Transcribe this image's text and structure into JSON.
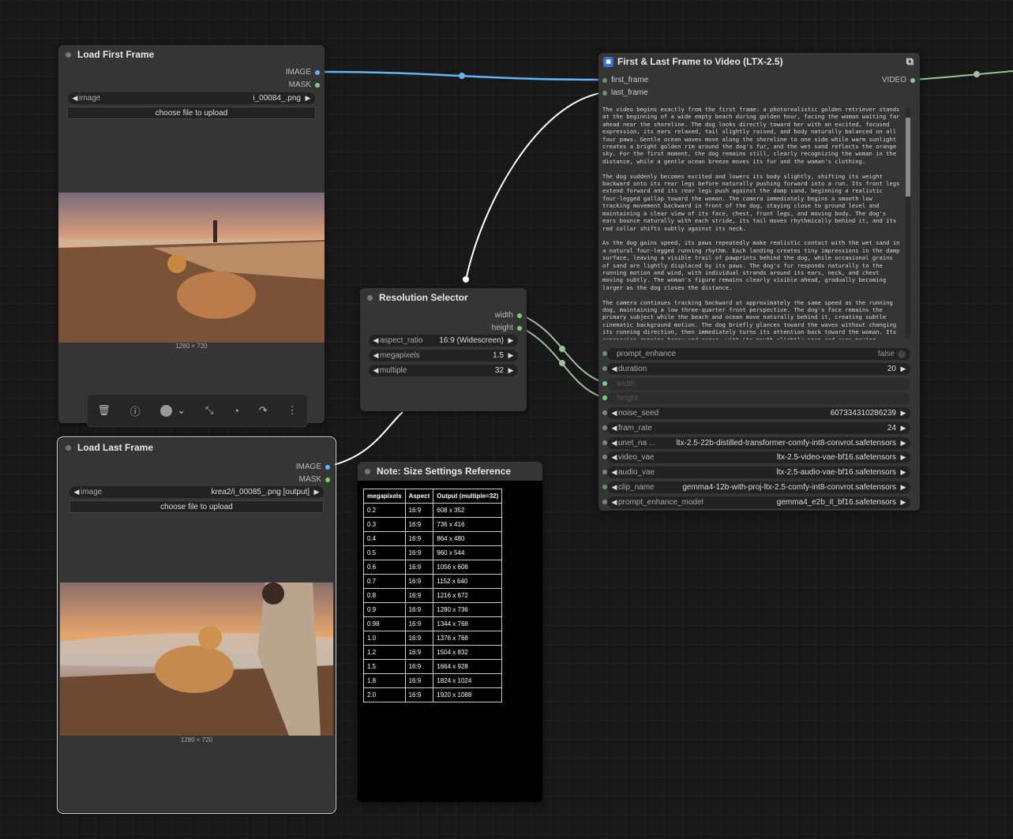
{
  "nodes": {
    "load_first": {
      "title": "Load First Frame",
      "out_image": "IMAGE",
      "out_mask": "MASK",
      "image_label": "image",
      "image_value": "i_00084_.png",
      "upload_label": "choose file to upload",
      "dims": "1280 × 720"
    },
    "load_last": {
      "title": "Load Last Frame",
      "out_image": "IMAGE",
      "out_mask": "MASK",
      "image_label": "image",
      "image_value": "krea2/i_00085_.png [output]",
      "upload_label": "choose file to upload",
      "dims": "1280 × 720"
    },
    "resolution": {
      "title": "Resolution Selector",
      "out_width": "width",
      "out_height": "height",
      "widgets": [
        {
          "label": "aspect_ratio",
          "value": "16:9 (Widescreen)"
        },
        {
          "label": "megapixels",
          "value": "1.5"
        },
        {
          "label": "multiple",
          "value": "32"
        }
      ]
    },
    "note": {
      "title": "Note: Size Settings Reference",
      "headers": [
        "megapixels",
        "Aspect",
        "Output (multiple=32)"
      ],
      "rows": [
        [
          "0.2",
          "16:9",
          "608 x 352"
        ],
        [
          "0.3",
          "16:9",
          "736 x 416"
        ],
        [
          "0.4",
          "16:9",
          "864 x 480"
        ],
        [
          "0.5",
          "16:9",
          "960 x 544"
        ],
        [
          "0.6",
          "16:9",
          "1056 x 608"
        ],
        [
          "0.7",
          "16:9",
          "1152 x 640"
        ],
        [
          "0.8",
          "16:9",
          "1216 x 672"
        ],
        [
          "0.9",
          "16:9",
          "1280 x 736"
        ],
        [
          "0.98",
          "16:9",
          "1344 x 768"
        ],
        [
          "1.0",
          "16:9",
          "1376 x 768"
        ],
        [
          "1.2",
          "16:9",
          "1504 x 832"
        ],
        [
          "1.5",
          "16:9",
          "1664 x 928"
        ],
        [
          "1.8",
          "16:9",
          "1824 x 1024"
        ],
        [
          "2.0",
          "16:9",
          "1920 x 1088"
        ]
      ]
    },
    "ltx": {
      "title": "First & Last Frame to Video (LTX-2.5)",
      "in_first": "first_frame",
      "in_last": "last_frame",
      "out_video": "VIDEO",
      "prompt": "The video begins exactly from the first frame: a photorealistic golden retriever stands at the beginning of a wide empty beach during golden hour, facing the woman waiting far ahead near the shoreline. The dog looks directly toward her with an excited, focused expression, its ears relaxed, tail slightly raised, and body naturally balanced on all four paws. Gentle ocean waves move along the shoreline to one side while warm sunlight creates a bright golden rim around the dog's fur, and the wet sand reflects the orange sky. For the first moment, the dog remains still, clearly recognizing the woman in the distance, while a gentle ocean breeze moves its fur and the woman's clothing.\n\nThe dog suddenly becomes excited and lowers its body slightly, shifting its weight backward onto its rear legs before naturally pushing forward into a run. Its front legs extend forward and its rear legs push against the damp sand, beginning a realistic four-legged gallop toward the woman. The camera immediately begins a smooth low tracking movement backward in front of the dog, staying close to ground level and maintaining a clear view of its face, chest, front legs, and moving body. The dog's ears bounce naturally with each stride, its tail moves rhythmically behind it, and its red collar shifts subtly against its neck.\n\nAs the dog gains speed, its paws repeatedly make realistic contact with the wet sand in a natural four-legged running rhythm. Each landing creates tiny impressions in the damp surface, leaving a visible trail of pawprints behind the dog, while occasional grains of sand are lightly displaced by its paws. The dog's fur responds naturally to the running motion and wind, with individual strands around its ears, neck, and chest moving subtly. The woman's figure remains clearly visible ahead, gradually becoming larger as the dog closes the distance.\n\nThe camera continues tracking backward at approximately the same speed as the running dog, maintaining a low three-quarter front perspective. The dog's face remains the primary subject while the beach and ocean move naturally behind it, creating subtle cinematic background motion. The dog briefly glances toward the waves without changing its running direction, then immediately turns its attention back toward the woman. Its expression remains happy and eager, with its mouth slightly open and ears moving",
      "widgets": [
        {
          "label": "prompt_enhance",
          "value": "false"
        },
        {
          "label": "duration",
          "value": "20"
        },
        {
          "label": "width",
          "value": ""
        },
        {
          "label": "height",
          "value": ""
        },
        {
          "label": "noise_seed",
          "value": "607334310286239"
        },
        {
          "label": "fram_rate",
          "value": "24"
        },
        {
          "label": "unet_na ...",
          "value": "ltx-2.5-22b-distilled-transformer-comfy-int8-convrot.safetensors"
        },
        {
          "label": "video_vae",
          "value": "ltx-2.5-video-vae-bf16.safetensors"
        },
        {
          "label": "audio_vae",
          "value": "ltx-2.5-audio-vae-bf16.safetensors"
        },
        {
          "label": "clip_name",
          "value": "gemma4-12b-with-proj-ltx-2.5-comfy-int8-convrot.safetensors"
        },
        {
          "label": "prompt_enhance_model",
          "value": "gemma4_e2b_it_bf16.safetensors"
        }
      ]
    }
  },
  "toolbar": {
    "icons": [
      "trash-icon",
      "info-icon",
      "color-icon",
      "chevron-down-icon",
      "collapse-icon",
      "bypass-icon",
      "redo-icon",
      "more-icon"
    ]
  },
  "colors": {
    "image_link": "#64b5f6",
    "int_link": "#9fbf9f",
    "canvas": "#181818",
    "node": "#353535"
  }
}
